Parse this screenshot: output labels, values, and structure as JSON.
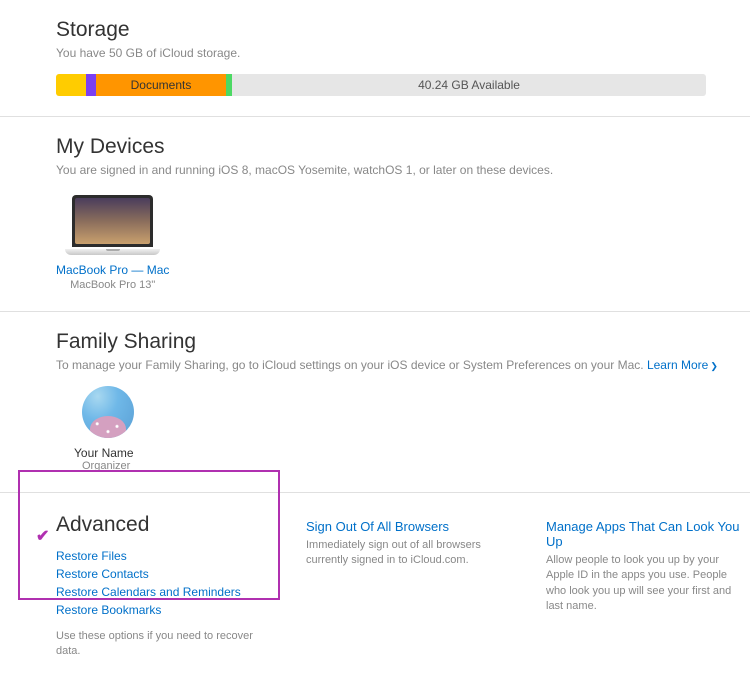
{
  "storage": {
    "title": "Storage",
    "subtitle": "You have 50 GB of iCloud storage.",
    "documents_label": "Documents",
    "available_label": "40.24 GB Available"
  },
  "devices": {
    "title": "My Devices",
    "subtitle": "You are signed in and running iOS 8, macOS Yosemite, watchOS 1, or later on these devices.",
    "items": [
      {
        "name": "MacBook Pro — Mac",
        "model": "MacBook Pro 13\""
      }
    ]
  },
  "family": {
    "title": "Family Sharing",
    "subtitle_prefix": "To manage your Family Sharing, go to iCloud settings on your iOS device or System Preferences on your Mac. ",
    "learn_more": "Learn More",
    "member_name": "Your Name",
    "member_role": "Organizer"
  },
  "advanced": {
    "title": "Advanced",
    "links": {
      "restore_files": "Restore Files",
      "restore_contacts": "Restore Contacts",
      "restore_calendars": "Restore Calendars and Reminders",
      "restore_bookmarks": "Restore Bookmarks"
    },
    "footnote": "Use these options if you need to recover data."
  },
  "signout": {
    "title": "Sign Out Of All Browsers",
    "desc": "Immediately sign out of all browsers currently signed in to iCloud.com."
  },
  "manage": {
    "title": "Manage Apps That Can Look You Up",
    "desc": "Allow people to look you up by your Apple ID in the apps you use. People who look you up will see your first and last name."
  }
}
